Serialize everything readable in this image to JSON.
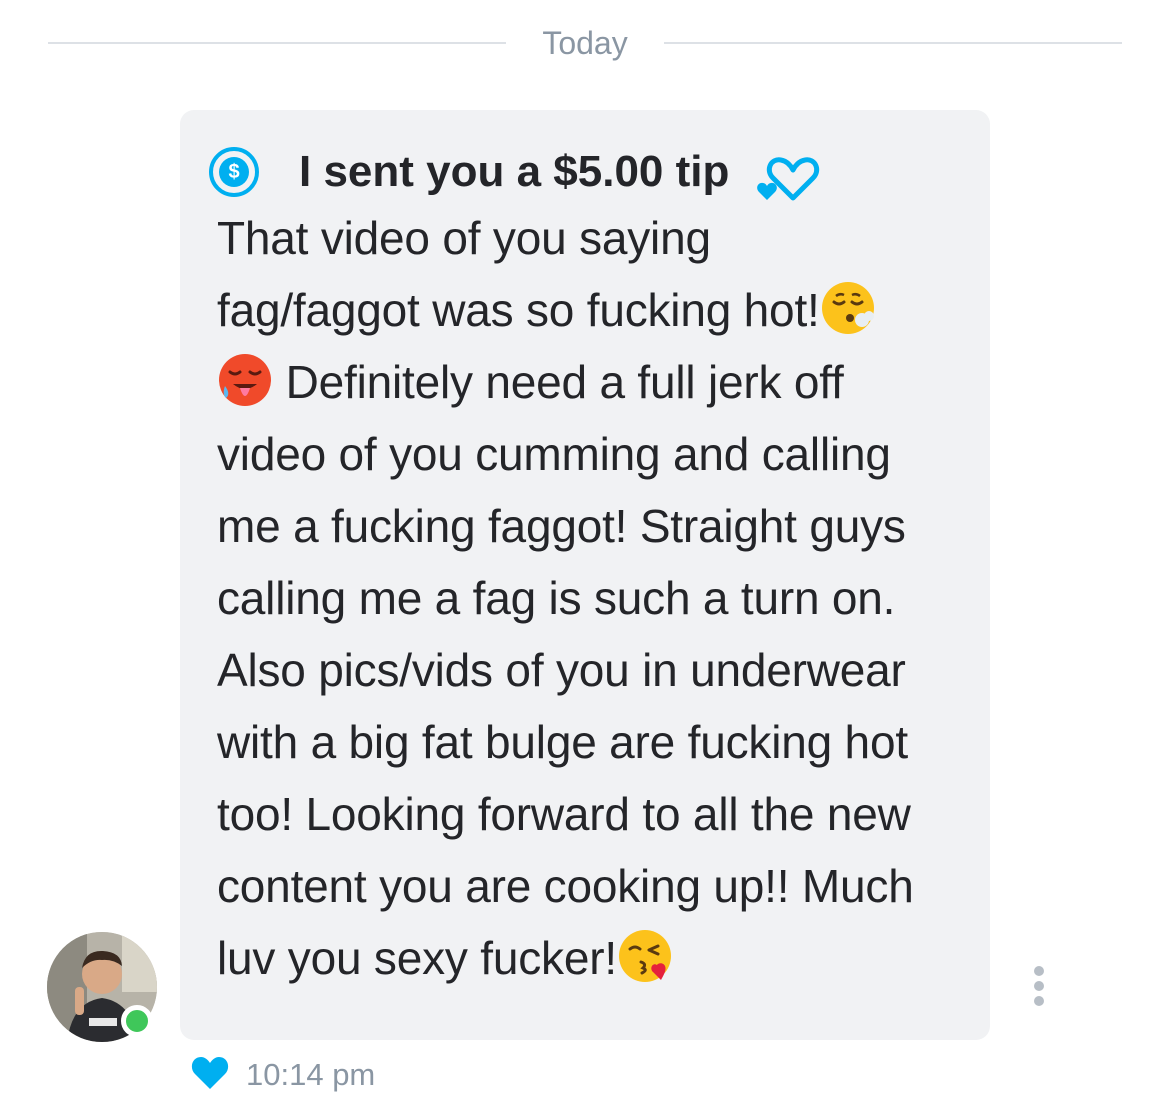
{
  "divider": {
    "label": "Today"
  },
  "message": {
    "tip_text": "I sent you a $5.00 tip",
    "line1": "That video of you saying",
    "line2": "fag/faggot was so fucking hot!",
    "line3": " Definitely need a full jerk off",
    "line4": "video of you cumming and calling",
    "line5": "me a fucking faggot! Straight guys",
    "line6": "calling me a fag is such a turn on.",
    "line7": "Also pics/vids of you in underwear",
    "line8": "with a big fat bulge are fucking hot",
    "line9": "too! Looking forward to all the new",
    "line10": "content you are cooking up!! Much",
    "line11": "luv you sexy fucker!",
    "time": "10:14 pm",
    "icons": [
      "dollar-icon",
      "hearts-icon",
      "exhaling-face-emoji",
      "hot-face-emoji",
      "kissing-face-emoji",
      "more-options-icon",
      "like-heart-icon"
    ]
  },
  "colors": {
    "accent": "#00aff0",
    "bubble": "#f1f2f4",
    "text": "#242529",
    "muted": "#8a96a3",
    "online": "#3fc75a"
  }
}
